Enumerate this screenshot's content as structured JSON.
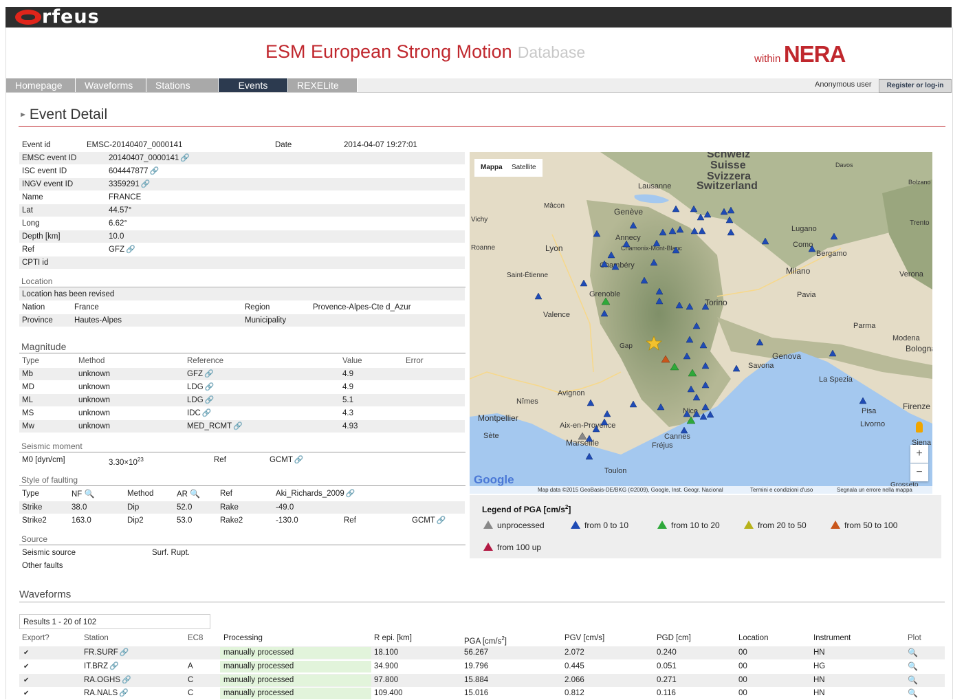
{
  "header": {
    "logo_text": "rfeus",
    "title": "ESM European Strong Motion",
    "title_db": "Database",
    "within": "within",
    "nera": "NERA"
  },
  "nav": {
    "tabs": [
      "Homepage",
      "Waveforms",
      "Stations",
      "Events",
      "REXELite"
    ],
    "active_tab": "Events",
    "user": "Anonymous user",
    "register": "Register or log-in"
  },
  "page": {
    "heading": "Event Detail"
  },
  "event": {
    "event_id_label": "Event id",
    "event_id": "EMSC-20140407_0000141",
    "date_label": "Date",
    "date": "2014-04-07 19:27:01",
    "emsc_label": "EMSC event ID",
    "emsc": "20140407_0000141",
    "isc_label": "ISC event ID",
    "isc": "604447877",
    "ingv_label": "INGV event ID",
    "ingv": "3359291",
    "name_label": "Name",
    "name": "FRANCE",
    "lat_label": "Lat",
    "lat": "44.57°",
    "long_label": "Long",
    "long": "6.62°",
    "depth_label": "Depth [km]",
    "depth": "10.0",
    "ref_label": "Ref",
    "ref": "GFZ",
    "cpti_label": "CPTI id"
  },
  "location": {
    "heading": "Location",
    "revised": "Location has been revised",
    "nation_label": "Nation",
    "nation": "France",
    "region_label": "Region",
    "region": "Provence-Alpes-Cte d_Azur",
    "province_label": "Province",
    "province": "Hautes-Alpes",
    "municipality_label": "Municipality"
  },
  "magnitude": {
    "heading": "Magnitude",
    "columns": [
      "Type",
      "Method",
      "Reference",
      "Value",
      "Error"
    ],
    "rows": [
      {
        "type": "Mb",
        "method": "unknown",
        "reference": "GFZ",
        "value": "4.9"
      },
      {
        "type": "MD",
        "method": "unknown",
        "reference": "LDG",
        "value": "4.9"
      },
      {
        "type": "ML",
        "method": "unknown",
        "reference": "LDG",
        "value": "5.1"
      },
      {
        "type": "MS",
        "method": "unknown",
        "reference": "IDC",
        "value": "4.3"
      },
      {
        "type": "Mw",
        "method": "unknown",
        "reference": "MED_RCMT",
        "value": "4.93"
      }
    ]
  },
  "moment": {
    "heading": "Seismic moment",
    "label": "M0 [dyn/cm]",
    "value": "3.30×10",
    "exp": "23",
    "ref_label": "Ref",
    "ref": "GCMT"
  },
  "faulting": {
    "heading": "Style of faulting",
    "type_label": "Type",
    "type": "NF",
    "method_label": "Method",
    "method": "AR",
    "ref_label": "Ref",
    "ref": "Aki_Richards_2009",
    "strike_label": "Strike",
    "strike": "38.0",
    "dip_label": "Dip",
    "dip": "52.0",
    "rake_label": "Rake",
    "rake": "-49.0",
    "strike2_label": "Strike2",
    "strike2": "163.0",
    "dip2_label": "Dip2",
    "dip2": "53.0",
    "rake2_label": "Rake2",
    "rake2": "-130.0",
    "ref2_label": "Ref",
    "ref2": "GCMT"
  },
  "source": {
    "heading": "Source",
    "seismic_label": "Seismic source",
    "seismic": "Surf. Rupt.",
    "other_label": "Other faults"
  },
  "map": {
    "tab_map": "Mappa",
    "tab_satellite": "Satellite",
    "attribution": "Map data ©2015 GeoBasis-DE/BKG (©2009), Google, Inst. Geogr. Nacional",
    "terms": "Termini e condizioni d'uso",
    "report": "Segnala un errore nella mappa",
    "google": "Google",
    "labels": [
      "Schweiz",
      "Suisse",
      "Svizzera",
      "Switzerland",
      "Lausanne",
      "Genève",
      "Annecy",
      "Chamonix-Mont-Blanc",
      "Lyon",
      "Chambéry",
      "Saint-Étienne",
      "Grenoble",
      "Valence",
      "Torino",
      "Milano",
      "Como",
      "Bergamo",
      "Lugano",
      "Pavia",
      "Verona",
      "Parma",
      "Modena",
      "Bologna",
      "Genova",
      "Savona",
      "La Spezia",
      "Firenze",
      "Pisa",
      "Livorno",
      "Siena",
      "Avignon",
      "Nîmes",
      "Montpellier",
      "Sète",
      "Aix-en-Provence",
      "Marseille",
      "Toulon",
      "Cannes",
      "Nice",
      "Fréjus",
      "Mâcon",
      "Vichy",
      "Gap",
      "Davos",
      "Bolzano",
      "Trento",
      "Grosseto",
      "Roanne"
    ],
    "colors": {
      "water": "#a4c8ef",
      "land": "#e3dbc4",
      "mountain": "#9cab82"
    }
  },
  "legend": {
    "title": "Legend of PGA [cm/s",
    "title_sup": "2",
    "title_end": "]",
    "items": [
      {
        "label": "unprocessed",
        "color": "#888888"
      },
      {
        "label": "from 0 to 10",
        "color": "#1f4bb5"
      },
      {
        "label": "from 10 to 20",
        "color": "#2ea83a"
      },
      {
        "label": "from 20 to 50",
        "color": "#b7b21a"
      },
      {
        "label": "from 50 to 100",
        "color": "#c9561b"
      },
      {
        "label": "from 100 up",
        "color": "#b31a44"
      }
    ]
  },
  "waveforms": {
    "heading": "Waveforms",
    "results": "Results 1 - 20 of 102",
    "columns": [
      "Export?",
      "Station",
      "EC8",
      "Processing",
      "R epi. [km]",
      "PGA [cm/s",
      "PGV [cm/s]",
      "PGD [cm]",
      "Location",
      "Instrument",
      "Plot"
    ],
    "pga_sup": "2",
    "pga_end": "]",
    "rows": [
      {
        "station": "FR.SURF",
        "ec8": "",
        "processing": "manually processed",
        "repi": "18.100",
        "pga": "56.267",
        "pgv": "2.072",
        "pgd": "0.240",
        "location": "00",
        "instrument": "HN"
      },
      {
        "station": "IT.BRZ",
        "ec8": "A",
        "processing": "manually processed",
        "repi": "34.900",
        "pga": "19.796",
        "pgv": "0.445",
        "pgd": "0.051",
        "location": "00",
        "instrument": "HG"
      },
      {
        "station": "RA.OGHS",
        "ec8": "C",
        "processing": "manually processed",
        "repi": "97.800",
        "pga": "15.884",
        "pgv": "2.066",
        "pgd": "0.271",
        "location": "00",
        "instrument": "HN"
      },
      {
        "station": "RA.NALS",
        "ec8": "C",
        "processing": "manually processed",
        "repi": "109.400",
        "pga": "15.016",
        "pgv": "0.812",
        "pgd": "0.116",
        "location": "00",
        "instrument": "HN"
      }
    ]
  }
}
